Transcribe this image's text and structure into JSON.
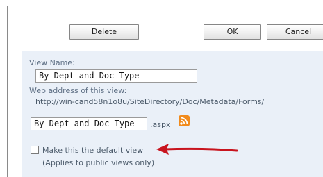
{
  "toolbar": {
    "delete_label": "Delete",
    "ok_label": "OK",
    "cancel_label": "Cancel"
  },
  "form": {
    "view_name_label": "View Name:",
    "view_name_value": "By Dept and Doc Type",
    "web_address_label": "Web address of this view:",
    "url_prefix": "http://win-cand58n1o8u/SiteDirectory/Doc/Metadata/Forms/",
    "url_page_value": "By Dept and Doc Type",
    "url_extension": ".aspx",
    "default_view_label": "Make this the default view",
    "default_view_note": "(Applies to public views only)",
    "default_view_checked": false
  },
  "icons": {
    "feed": "rss-icon",
    "annotation": "red-arrow-icon"
  },
  "colors": {
    "panel_bg": "#eaf0f8",
    "arrow": "#c8141e",
    "rss": "#f18b1d"
  }
}
